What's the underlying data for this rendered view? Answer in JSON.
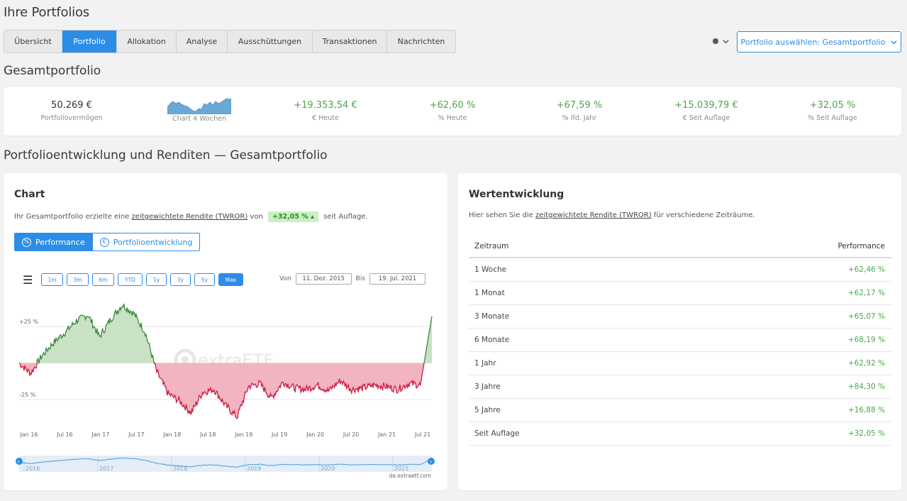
{
  "page": {
    "title": "Ihre Portfolios"
  },
  "tabs": [
    {
      "label": "Übersicht",
      "active": false
    },
    {
      "label": "Portfolio",
      "active": true
    },
    {
      "label": "Allokation",
      "active": false
    },
    {
      "label": "Analyse",
      "active": false
    },
    {
      "label": "Ausschüttungen",
      "active": false
    },
    {
      "label": "Transaktionen",
      "active": false
    },
    {
      "label": "Nachrichten",
      "active": false
    }
  ],
  "toolbar": {
    "portfolio_select": "Portfolio auswählen: Gesamtportfolio",
    "settings_icon": "gear-icon"
  },
  "summary": {
    "title": "Gesamtportfolio",
    "kpis": [
      {
        "value": "50.269 €",
        "label": "Portfoliovermögen"
      },
      {
        "value": "",
        "label": "Chart 4 Wochen"
      },
      {
        "value": "+19.353,54 €",
        "label": "€ Heute"
      },
      {
        "value": "+62,60 %",
        "label": "% Heute"
      },
      {
        "value": "+67,59 %",
        "label": "% lfd. Jahr"
      },
      {
        "value": "+15.039,79 €",
        "label": "€ Seit Auflage"
      },
      {
        "value": "+32,05 %",
        "label": "% Seit Auflage"
      }
    ]
  },
  "section": {
    "title": "Portfolioentwicklung und Renditen — Gesamtportfolio"
  },
  "chart_card": {
    "title": "Chart",
    "desc_prefix": "Ihr Gesamtportfolio erzielte eine",
    "desc_link": "zeitgewichtete Rendite (TWROR)",
    "desc_mid": "von",
    "badge": "+32,05 %",
    "desc_suffix": "seit Auflage.",
    "toggle": {
      "performance": "Performance",
      "development": "Portfolioentwicklung"
    },
    "ranges": [
      "1m",
      "3m",
      "6m",
      "YTD",
      "1y",
      "3y",
      "5y",
      "Max"
    ],
    "active_range": "Max",
    "date_from_label": "Von",
    "date_from": "11. Dez. 2015",
    "date_to_label": "Bis",
    "date_to": "19. Jul. 2021",
    "watermark": "extraETF",
    "credit": "de.extraetf.com",
    "navigator_years": [
      "2016",
      "2017",
      "2018",
      "2019",
      "2020",
      "2021"
    ]
  },
  "chart_data": {
    "type": "area",
    "y_ticks": [
      "+25 %",
      "-25 %"
    ],
    "x_ticks": [
      "Jan 16",
      "Jul 16",
      "Jan 17",
      "Jul 17",
      "Jan 18",
      "Jul 18",
      "Jan 19",
      "Jul 19",
      "Jan 20",
      "Jul 20",
      "Jan 21",
      "Jul 21"
    ],
    "x": [
      "Dez 15",
      "Jan 16",
      "Feb 16",
      "Apr 16",
      "Jun 16",
      "Jul 16",
      "Sep 16",
      "Nov 16",
      "Jan 17",
      "Mär 17",
      "Mai 17",
      "Jul 17",
      "Aug 17",
      "Okt 17",
      "Dez 17",
      "Feb 18",
      "Apr 18",
      "Jun 18",
      "Aug 18",
      "Okt 18",
      "Dez 18",
      "Feb 19",
      "Apr 19",
      "Jun 19",
      "Aug 19",
      "Okt 19",
      "Dez 19",
      "Feb 20",
      "Apr 20",
      "Jun 20",
      "Aug 20",
      "Okt 20",
      "Dez 20",
      "Feb 21",
      "Apr 21",
      "Jun 21",
      "Jul 21"
    ],
    "values": [
      0,
      -7,
      5,
      14,
      21,
      29,
      33,
      18,
      30,
      40,
      34,
      21,
      -6,
      -21,
      -26,
      -34,
      -20,
      -18,
      -29,
      -37,
      -16,
      -14,
      -24,
      -13,
      -17,
      -18,
      -15,
      -19,
      -12,
      -18,
      -17,
      -15,
      -16,
      -18,
      -14,
      -15,
      32
    ],
    "ylim": [
      -40,
      45
    ]
  },
  "values_card": {
    "title": "Wertentwicklung",
    "desc_prefix": "Hier sehen Sie die",
    "desc_link": "zeitgewichtete Rendite (TWROR)",
    "desc_suffix": "für verschiedene Zeiträume.",
    "col_period": "Zeitraum",
    "col_perf": "Performance",
    "rows": [
      {
        "period": "1 Woche",
        "perf": "+62,46 %"
      },
      {
        "period": "1 Monat",
        "perf": "+62,17 %"
      },
      {
        "period": "3 Monate",
        "perf": "+65,07 %"
      },
      {
        "period": "6 Monate",
        "perf": "+68,19 %"
      },
      {
        "period": "1 Jahr",
        "perf": "+62,92 %"
      },
      {
        "period": "3 Jahre",
        "perf": "+84,30 %"
      },
      {
        "period": "5 Jahre",
        "perf": "+16,88 %"
      },
      {
        "period": "Seit Auflage",
        "perf": "+32,05 %"
      }
    ]
  }
}
